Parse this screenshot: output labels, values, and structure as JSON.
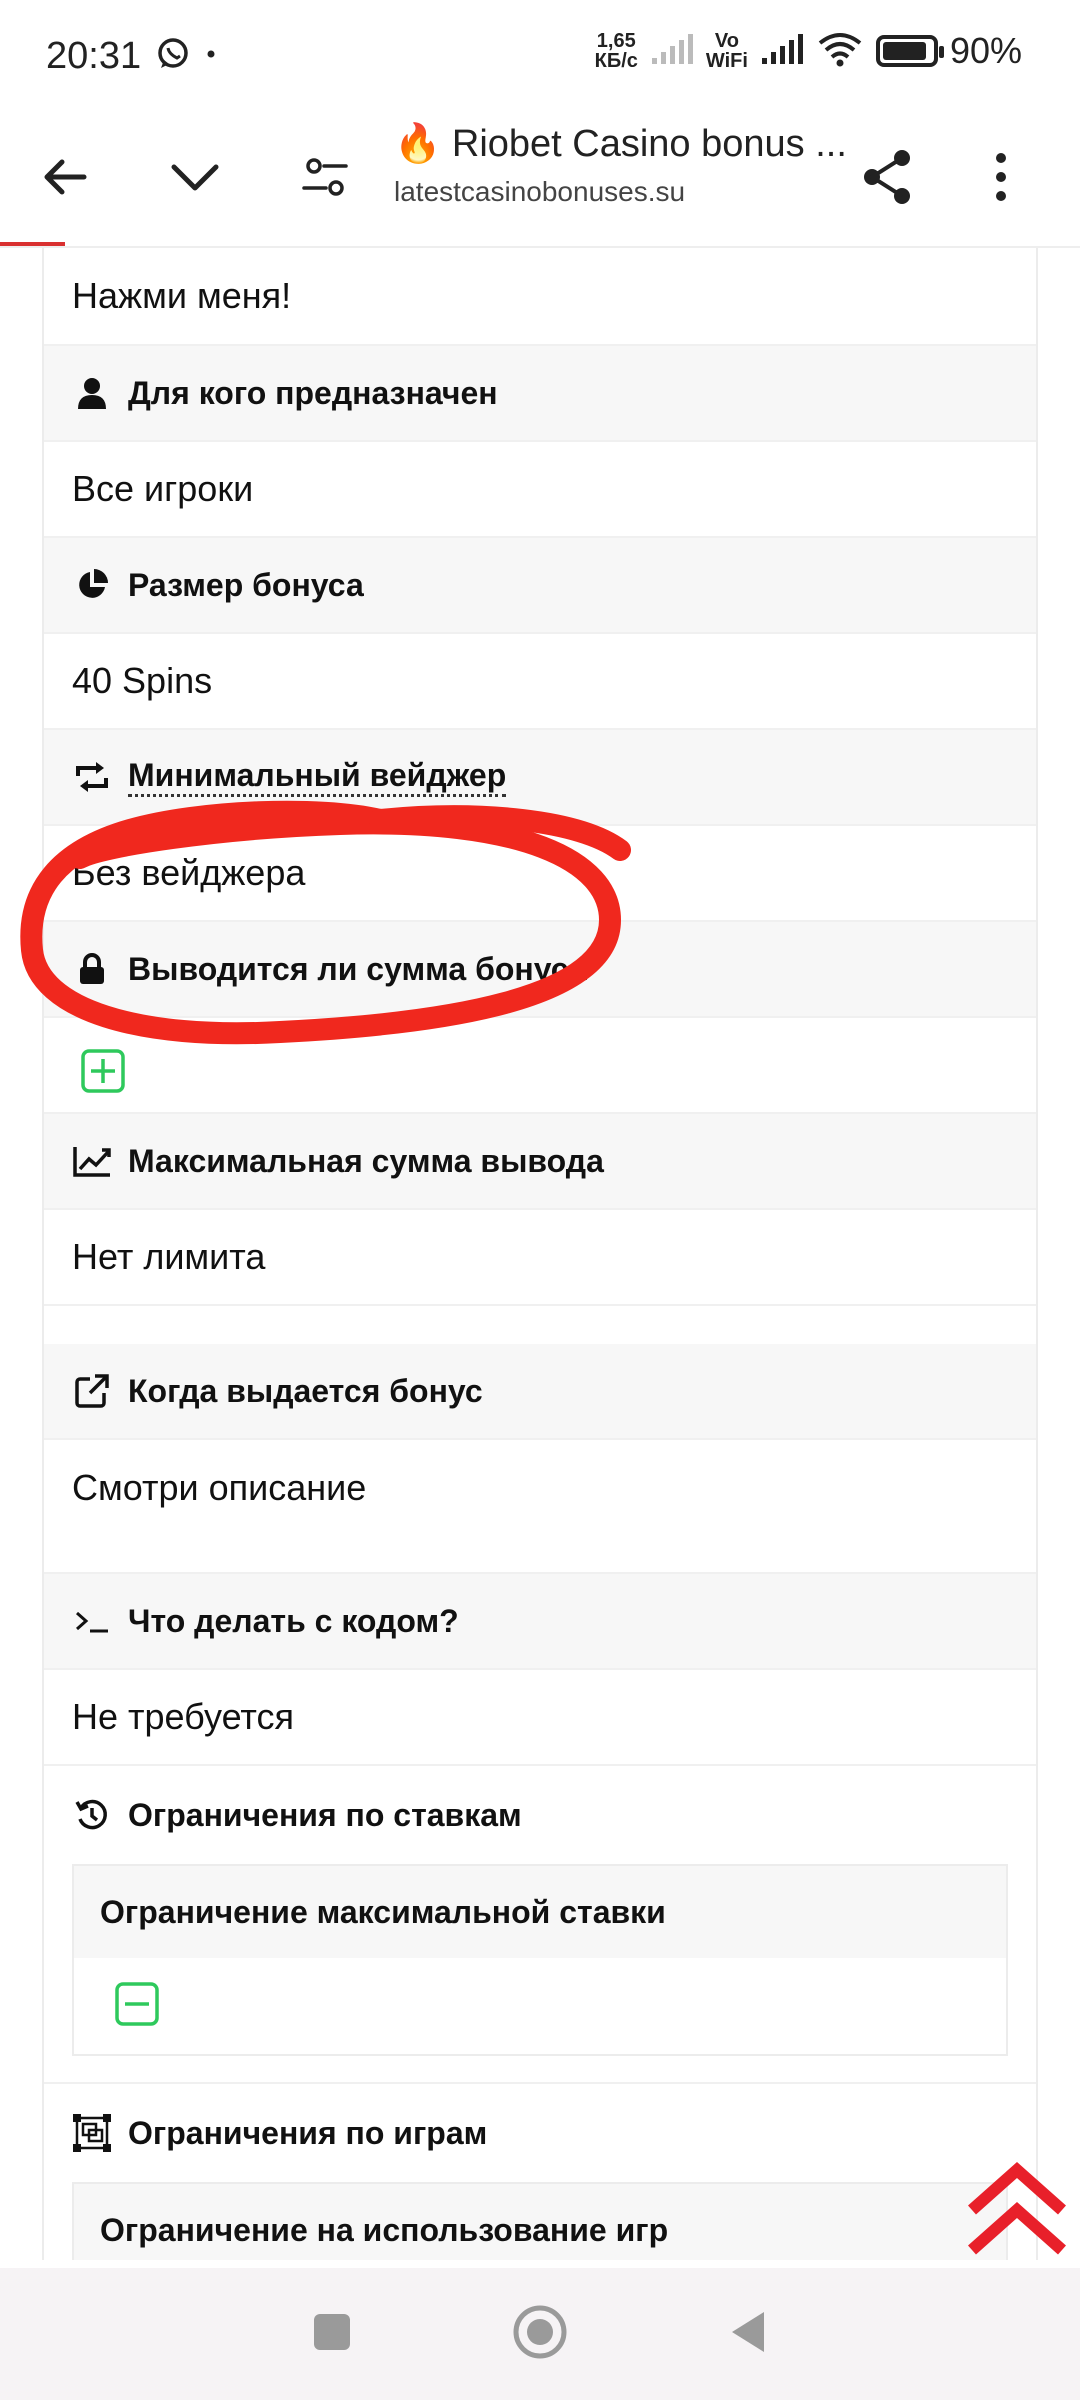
{
  "status_bar": {
    "time": "20:31",
    "net_speed_top": "1,65",
    "net_speed_bottom": "КБ/с",
    "vowifi_top": "Vo",
    "vowifi_bottom": "WiFi",
    "battery": "90%",
    "battery_level": 0.9,
    "icons": [
      "whatsapp-icon",
      "signal-icon",
      "wifi-icon",
      "battery-icon"
    ]
  },
  "toolbar": {
    "title": "🔥 Riobet Casino bonus ...",
    "url": "latestcasinobonuses.su",
    "page_load_progress": 0.06,
    "icons": [
      "back-arrow-icon",
      "chevron-down-icon",
      "tune-icon",
      "share-icon",
      "more-vert-icon"
    ]
  },
  "content": {
    "top_text": "Нажми меня!",
    "sections": [
      {
        "heading": "Для кого предназначен",
        "icon": "user-icon",
        "value": "Все игроки"
      },
      {
        "heading": "Размер бонуса",
        "icon": "pie-chart-icon",
        "value": "40 Spins"
      },
      {
        "heading": "Минимальный вейджер",
        "icon": "retweet-icon",
        "value": "Без вейджера"
      },
      {
        "heading": "Выводится ли сумма бонуса",
        "icon": "lock-icon",
        "value_icon": "plus-square-icon"
      },
      {
        "heading": "Максимальная сумма вывода",
        "icon": "line-chart-icon",
        "value": "Нет лимита"
      },
      {
        "heading": "Когда выдается бонус",
        "icon": "external-link-icon",
        "value": "Смотри описание"
      },
      {
        "heading": "Что делать с кодом?",
        "icon": "terminal-icon",
        "value": "Не требуется"
      },
      {
        "heading": "Ограничения по ставкам",
        "icon": "history-icon"
      },
      {
        "heading": "Ограничения по играм",
        "icon": "object-group-icon"
      }
    ],
    "bet_limit_box": {
      "heading": "Ограничение максимальной ставки",
      "value_icon": "minus-square-icon"
    },
    "game_limit_box": {
      "heading": "Ограничение на использование игр"
    }
  },
  "colors": {
    "accent_red": "#d93030",
    "scribble_red": "#f0281e",
    "green": "#2ec95c",
    "header_bg": "#f7f7f7"
  },
  "nav_bar": {
    "icons": [
      "recent-apps-icon",
      "home-icon",
      "back-icon"
    ]
  }
}
